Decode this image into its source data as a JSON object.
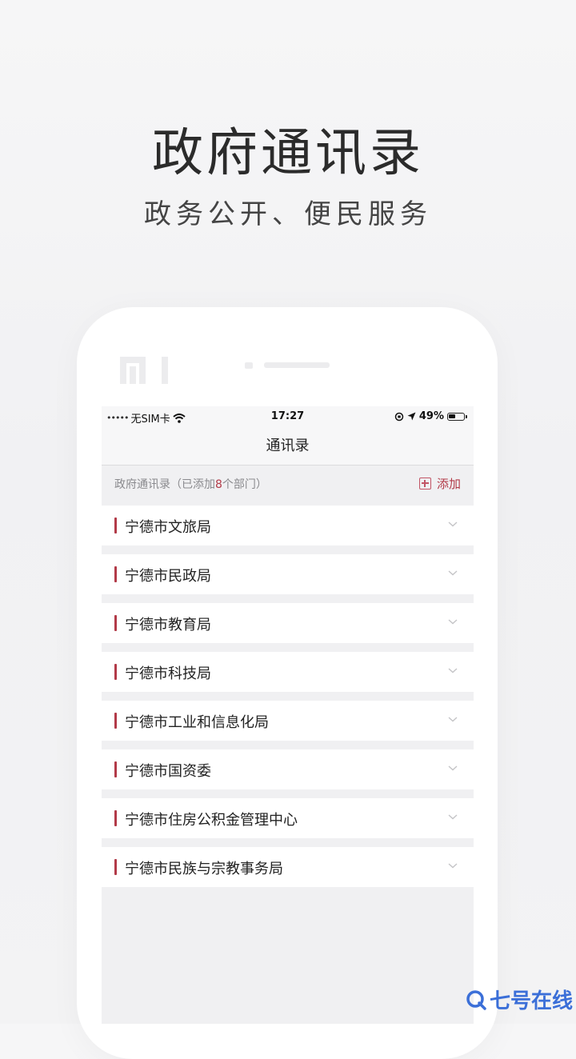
{
  "promo": {
    "headline": "政府通讯录",
    "subline": "政务公开、便民服务"
  },
  "status_bar": {
    "carrier": "无SIM卡",
    "time": "17:27",
    "battery": "49%",
    "battery_level": 0.49
  },
  "navbar": {
    "title": "通讯录"
  },
  "section": {
    "title_prefix": "政府通讯录（已添加",
    "count": "8",
    "title_suffix": "个部门）",
    "add_label": "添加"
  },
  "departments": [
    {
      "name": "宁德市文旅局"
    },
    {
      "name": "宁德市民政局"
    },
    {
      "name": "宁德市教育局"
    },
    {
      "name": "宁德市科技局"
    },
    {
      "name": "宁德市工业和信息化局"
    },
    {
      "name": "宁德市国资委"
    },
    {
      "name": "宁德市住房公积金管理中心"
    },
    {
      "name": "宁德市民族与宗教事务局"
    }
  ],
  "watermark": {
    "text": "七号在线"
  },
  "colors": {
    "accent": "#b23a48",
    "watermark": "#3b6fd8"
  }
}
